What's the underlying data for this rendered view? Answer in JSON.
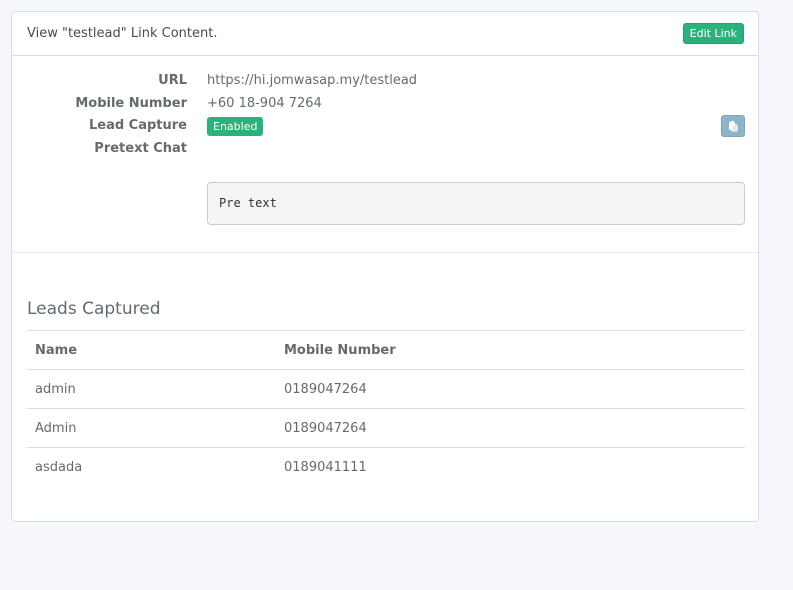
{
  "panel": {
    "title": "View \"testlead\" Link Content.",
    "edit_button": "Edit Link"
  },
  "details": {
    "url_label": "URL",
    "url_value": "https://hi.jomwasap.my/testlead",
    "mobile_label": "Mobile Number",
    "mobile_value": "+60 18-904 7264",
    "lead_capture_label": "Lead Capture",
    "lead_capture_status": "Enabled",
    "pretext_label": "Pretext Chat",
    "pretext_value": "Pre text",
    "copy_icon": "clipboard-icon"
  },
  "leads": {
    "title": "Leads Captured",
    "columns": [
      "Name",
      "Mobile Number"
    ],
    "rows": [
      {
        "name": "admin",
        "mobile": "0189047264"
      },
      {
        "name": "Admin",
        "mobile": "0189047264"
      },
      {
        "name": "asdada",
        "mobile": "0189041111"
      }
    ]
  },
  "colors": {
    "success": "#2ab27b",
    "info_button": "#8eb4cb",
    "border": "#d3e0e9",
    "background": "#f5f7fa"
  }
}
